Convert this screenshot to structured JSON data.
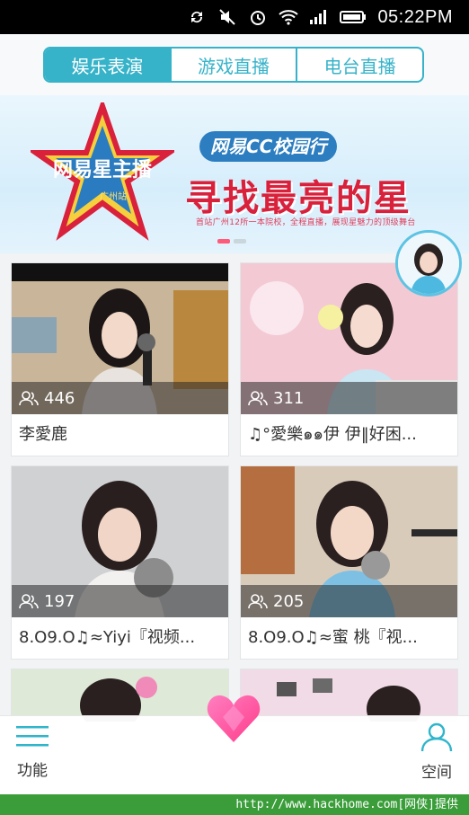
{
  "status_bar": {
    "time": "05:22PM"
  },
  "tabs": [
    {
      "label": "娱乐表演",
      "active": true
    },
    {
      "label": "游戏直播",
      "active": false
    },
    {
      "label": "电台直播",
      "active": false
    }
  ],
  "banner": {
    "badge_text": "网易星主播",
    "badge_sub": "广州站",
    "pill": "网易CC校园行",
    "headline": "寻找最亮的星",
    "subtitle": "首站广州12所一本院校，全程直播，展现星魅力的顶级舞台",
    "dots": 2,
    "active_dot": 0
  },
  "cards": [
    {
      "viewers": "446",
      "title": "李愛鹿"
    },
    {
      "viewers": "311",
      "title": "♫°愛樂๑๑伊 伊‖好困..."
    },
    {
      "viewers": "197",
      "title": "8.O9.O♫≈Yiyi『视频..."
    },
    {
      "viewers": "205",
      "title": "8.O9.O♫≈蜜 桃『视..."
    }
  ],
  "bottom_nav": {
    "left_label": "功能",
    "right_label": "空间"
  },
  "watermark": "http://www.hackhome.com[网侠]提供",
  "colors": {
    "accent": "#37b3c9",
    "heart": "#ff5aa0"
  }
}
